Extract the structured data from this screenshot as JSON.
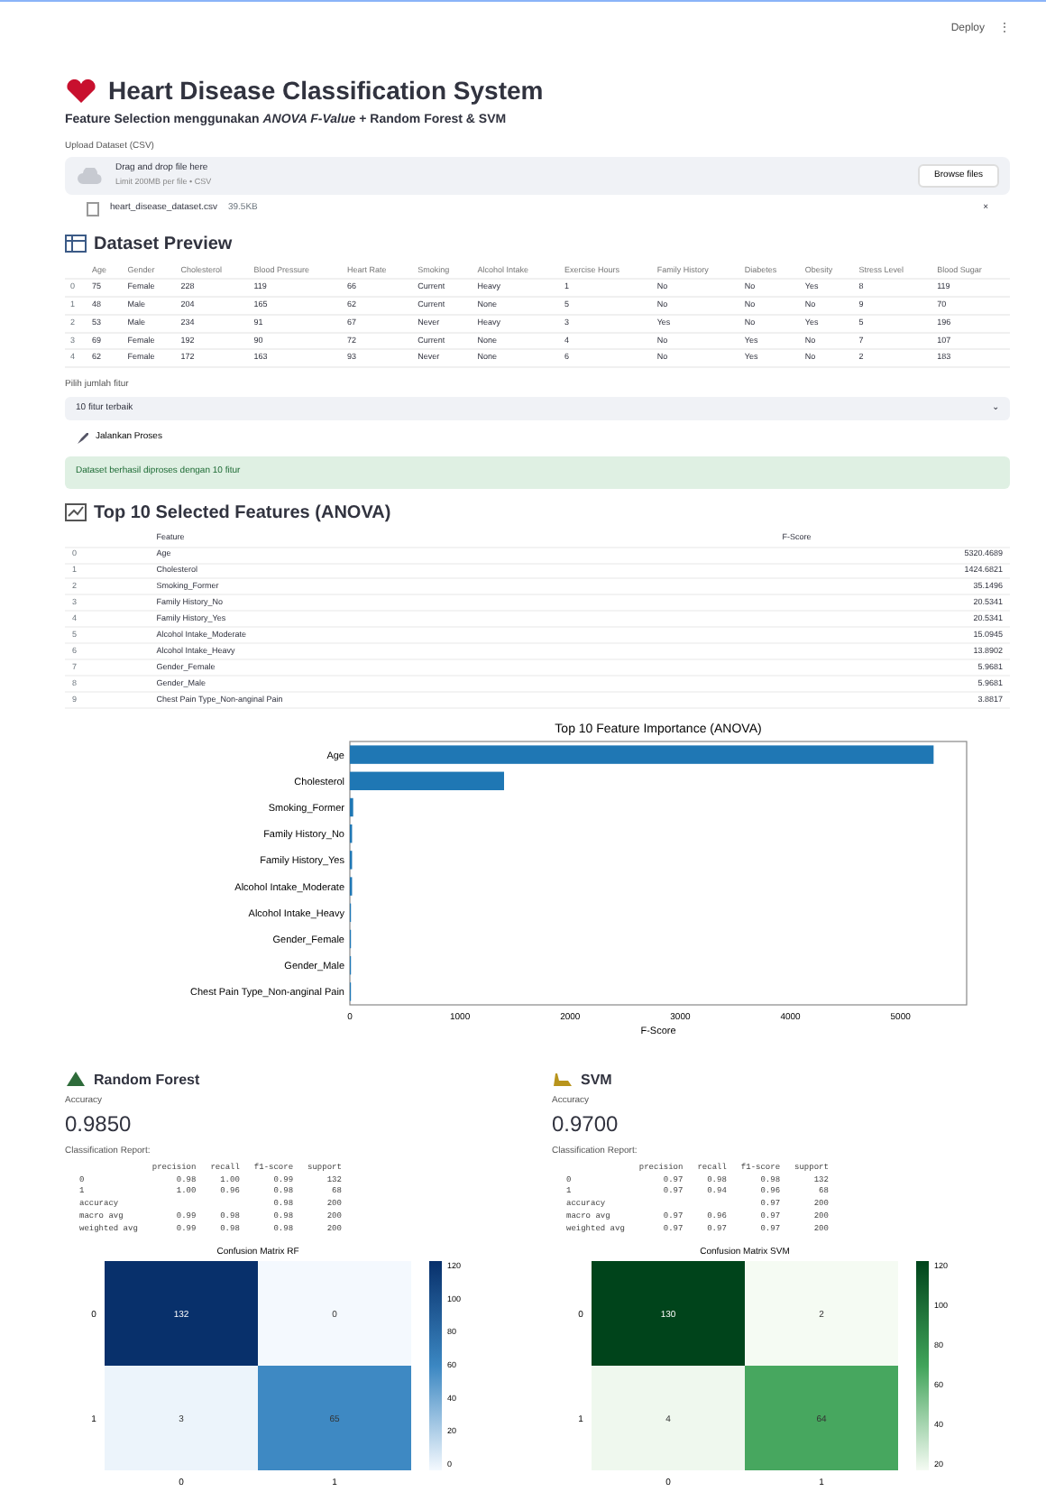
{
  "toolbar": {
    "deploy": "Deploy",
    "menu": "⋮"
  },
  "title": "Heart Disease Classification System",
  "subtitle": "Feature Selection menggunakan *ANOVA F-Value* + Random Forest & SVM",
  "uploader": {
    "label": "Upload Dataset (CSV)",
    "prompt": "Drag and drop file here",
    "limit": "Limit 200MB per file • CSV",
    "button": "Browse files"
  },
  "file": {
    "name": "heart_disease_dataset.csv",
    "size": "39.5KB",
    "remove": "×"
  },
  "preview": {
    "heading": "Dataset Preview",
    "columns": [
      "",
      "Age",
      "Gender",
      "Cholesterol",
      "Blood Pressure",
      "Heart Rate",
      "Smoking",
      "Alcohol Intake",
      "Exercise Hours",
      "Family History",
      "Diabetes",
      "Obesity",
      "Stress Level",
      "Blood Sugar"
    ],
    "rows": [
      [
        "0",
        "75",
        "Female",
        "228",
        "119",
        "66",
        "Current",
        "Heavy",
        "1",
        "No",
        "No",
        "Yes",
        "8",
        "119"
      ],
      [
        "1",
        "48",
        "Male",
        "204",
        "165",
        "62",
        "Current",
        "None",
        "5",
        "No",
        "No",
        "No",
        "9",
        "70"
      ],
      [
        "2",
        "53",
        "Male",
        "234",
        "91",
        "67",
        "Never",
        "Heavy",
        "3",
        "Yes",
        "No",
        "Yes",
        "5",
        "196"
      ],
      [
        "3",
        "69",
        "Female",
        "192",
        "90",
        "72",
        "Current",
        "None",
        "4",
        "No",
        "Yes",
        "No",
        "7",
        "107"
      ],
      [
        "4",
        "62",
        "Female",
        "172",
        "163",
        "93",
        "Never",
        "None",
        "6",
        "No",
        "Yes",
        "No",
        "2",
        "183"
      ]
    ]
  },
  "select": {
    "label": "Pilih jumlah fitur",
    "value": "10 fitur terbaik",
    "caret": "⌄"
  },
  "run_button": {
    "label": "Jalankan Proses"
  },
  "alert": "Dataset berhasil diproses dengan 10 fitur",
  "features": {
    "heading": "Top 10 Selected Features (ANOVA)",
    "columns": [
      "",
      "Feature",
      "F-Score"
    ],
    "rows": [
      [
        "0",
        "Age",
        "5320.4689"
      ],
      [
        "1",
        "Cholesterol",
        "1424.6821"
      ],
      [
        "2",
        "Smoking_Former",
        "35.1496"
      ],
      [
        "3",
        "Family History_No",
        "20.5341"
      ],
      [
        "4",
        "Family History_Yes",
        "20.5341"
      ],
      [
        "5",
        "Alcohol Intake_Moderate",
        "15.0945"
      ],
      [
        "6",
        "Alcohol Intake_Heavy",
        "13.8902"
      ],
      [
        "7",
        "Gender_Female",
        "5.9681"
      ],
      [
        "8",
        "Gender_Male",
        "5.9681"
      ],
      [
        "9",
        "Chest Pain Type_Non-anginal Pain",
        "3.8817"
      ]
    ]
  },
  "chart_data": {
    "type": "bar",
    "orientation": "horizontal",
    "title": "Top 10 Feature Importance (ANOVA)",
    "xlabel": "F-Score",
    "categories": [
      "Age",
      "Cholesterol",
      "Smoking_Former",
      "Family History_No",
      "Family History_Yes",
      "Alcohol Intake_Moderate",
      "Alcohol Intake_Heavy",
      "Gender_Female",
      "Gender_Male",
      "Chest Pain Type_Non-anginal Pain"
    ],
    "series": [
      {
        "color": "#1f77b4",
        "values": [
          5300,
          1400,
          30,
          20,
          20,
          20,
          10,
          10,
          10,
          0
        ]
      }
    ],
    "xlim": [
      0,
      5600
    ],
    "xticks": [
      0,
      1000,
      2000,
      3000,
      4000,
      5000
    ]
  },
  "models": [
    {
      "kind": "rf",
      "name": "Random Forest",
      "metric_label": "Accuracy",
      "metric": "0.9850",
      "report_label": "Classification Report:",
      "report": {
        "columns": [
          "",
          "precision",
          "recall",
          "f1-score",
          "support"
        ],
        "rows": [
          [
            "0",
            "0.98",
            "1.00",
            "0.99",
            "132"
          ],
          [
            "1",
            "1.00",
            "0.96",
            "0.98",
            "68"
          ],
          [
            "accuracy",
            "",
            "",
            "0.98",
            "200"
          ],
          [
            "macro avg",
            "0.99",
            "0.98",
            "0.98",
            "200"
          ],
          [
            "weighted avg",
            "0.99",
            "0.98",
            "0.98",
            "200"
          ]
        ]
      },
      "matrix_title": "Confusion Matrix RF",
      "matrix": [
        [
          "132",
          "0"
        ],
        [
          "3",
          "65"
        ]
      ],
      "ylabels": [
        "0",
        "1"
      ],
      "xlabels": [
        "0",
        "1"
      ],
      "colorbar_ticks": [
        "120",
        "100",
        "80",
        "60",
        "40",
        "20",
        "0"
      ]
    },
    {
      "kind": "svm",
      "name": "SVM",
      "metric_label": "Accuracy",
      "metric": "0.9700",
      "report_label": "Classification Report:",
      "report": {
        "columns": [
          "",
          "precision",
          "recall",
          "f1-score",
          "support"
        ],
        "rows": [
          [
            "0",
            "0.97",
            "0.98",
            "0.98",
            "132"
          ],
          [
            "1",
            "0.97",
            "0.94",
            "0.96",
            "68"
          ],
          [
            "accuracy",
            "",
            "",
            "0.97",
            "200"
          ],
          [
            "macro avg",
            "0.97",
            "0.96",
            "0.97",
            "200"
          ],
          [
            "weighted avg",
            "0.97",
            "0.97",
            "0.97",
            "200"
          ]
        ]
      },
      "matrix_title": "Confusion Matrix SVM",
      "matrix": [
        [
          "130",
          "2"
        ],
        [
          "4",
          "64"
        ]
      ],
      "ylabels": [
        "0",
        "1"
      ],
      "xlabels": [
        "0",
        "1"
      ],
      "colorbar_ticks": [
        "120",
        "100",
        "80",
        "60",
        "40",
        "20"
      ]
    }
  ]
}
